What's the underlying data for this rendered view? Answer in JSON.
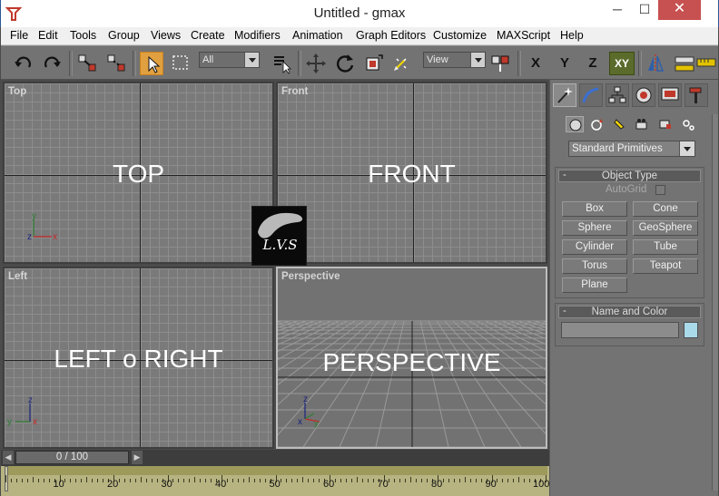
{
  "window": {
    "title": "Untitled - gmax",
    "min_label": "─",
    "max_label": "☐",
    "close_label": "✕"
  },
  "menu": [
    "File",
    "Edit",
    "Tools",
    "Group",
    "Views",
    "Create",
    "Modifiers",
    "Animation",
    "Graph Editors",
    "Customize",
    "MAXScript",
    "Help"
  ],
  "toolbar": {
    "selection_filter": "All",
    "coord_system": "View",
    "axis_x": "X",
    "axis_y": "Y",
    "axis_z": "Z",
    "axis_xy": "XY"
  },
  "viewports": {
    "top": {
      "label": "Top",
      "caption": "TOP"
    },
    "front": {
      "label": "Front",
      "caption": "FRONT"
    },
    "left": {
      "label": "Left",
      "caption": "LEFT o RIGHT"
    },
    "perspective": {
      "label": "Perspective",
      "caption": "PERSPECTIVE"
    }
  },
  "gizmo": {
    "x": "x",
    "y": "y",
    "z": "z"
  },
  "logo": {
    "text": "L.V.S"
  },
  "timeline": {
    "slider_value": "0 / 100",
    "ticks": [
      10,
      20,
      30,
      40,
      50,
      60,
      70,
      80,
      90,
      100
    ]
  },
  "command_panel": {
    "primitive_type": "Standard Primitives",
    "object_type": {
      "title": "Object Type",
      "autogrid": "AutoGrid",
      "buttons": [
        "Box",
        "Cone",
        "Sphere",
        "GeoSphere",
        "Cylinder",
        "Tube",
        "Torus",
        "Teapot",
        "Plane"
      ]
    },
    "name_color": {
      "title": "Name and Color",
      "swatch_color": "#a9daea"
    },
    "minus": "-"
  }
}
